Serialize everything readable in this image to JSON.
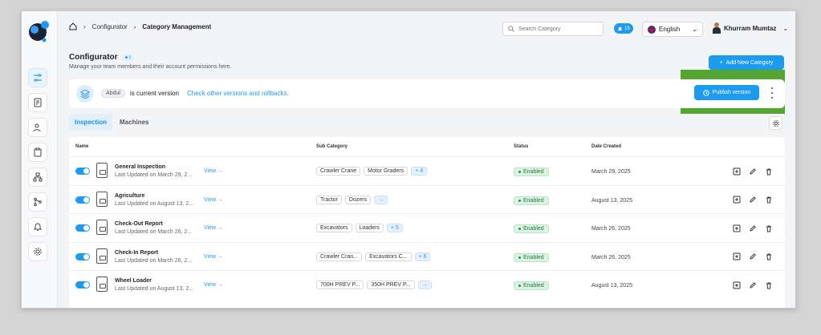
{
  "breadcrumb": {
    "items": [
      "Configurator",
      "Category Management"
    ]
  },
  "search": {
    "placeholder": "Search Category"
  },
  "notifications": {
    "count": "15"
  },
  "language": {
    "selected": "English"
  },
  "user": {
    "name": "Khurram Mumtaz"
  },
  "page": {
    "title": "Configurator",
    "count": "5",
    "subtitle": "Manage your team members and their account permissions here.",
    "add_button": "Add New Category"
  },
  "version": {
    "tag": "Abdul",
    "current_text": "is current version",
    "link_text": "Check other versions and rollbacks.",
    "publish_button": "Publish version"
  },
  "tabs": [
    "Inspection",
    "Machines"
  ],
  "table": {
    "columns": [
      "Name",
      "Sub Category",
      "Status",
      "Date Created"
    ],
    "view_label": "View",
    "rows": [
      {
        "name": "General Inspection",
        "updated": "Last Updated on March 29, 2...",
        "subs": [
          "Crawler Crane",
          "Motor Graders"
        ],
        "more": "+ 4",
        "status": "Enabled",
        "date": "March 29, 2025"
      },
      {
        "name": "Agriculture",
        "updated": "Last Updated on August 13, 2...",
        "subs": [
          "Tractor",
          "Dozers"
        ],
        "more": "→",
        "status": "Enabled",
        "date": "August 13, 2025"
      },
      {
        "name": "Check-Out Report",
        "updated": "Last Updated on March 26, 2...",
        "subs": [
          "Excavators",
          "Loaders"
        ],
        "more": "+ 5",
        "status": "Enabled",
        "date": "March 26, 2025"
      },
      {
        "name": "Check-In Report",
        "updated": "Last Updated on March 26, 2...",
        "subs": [
          "Crawler Cran...",
          "Excavators C..."
        ],
        "more": "+ 6",
        "status": "Enabled",
        "date": "March 26, 2025"
      },
      {
        "name": "Wheel Loader",
        "updated": "Last Updated on August 13, 2...",
        "subs": [
          "700H PREV P...",
          "350H PREV P..."
        ],
        "more": "→",
        "status": "Enabled",
        "date": "August 13, 2025"
      }
    ]
  },
  "colors": {
    "accent": "#1d9bf0",
    "highlight": "#55a630",
    "enabled": "#1f7a3d"
  }
}
